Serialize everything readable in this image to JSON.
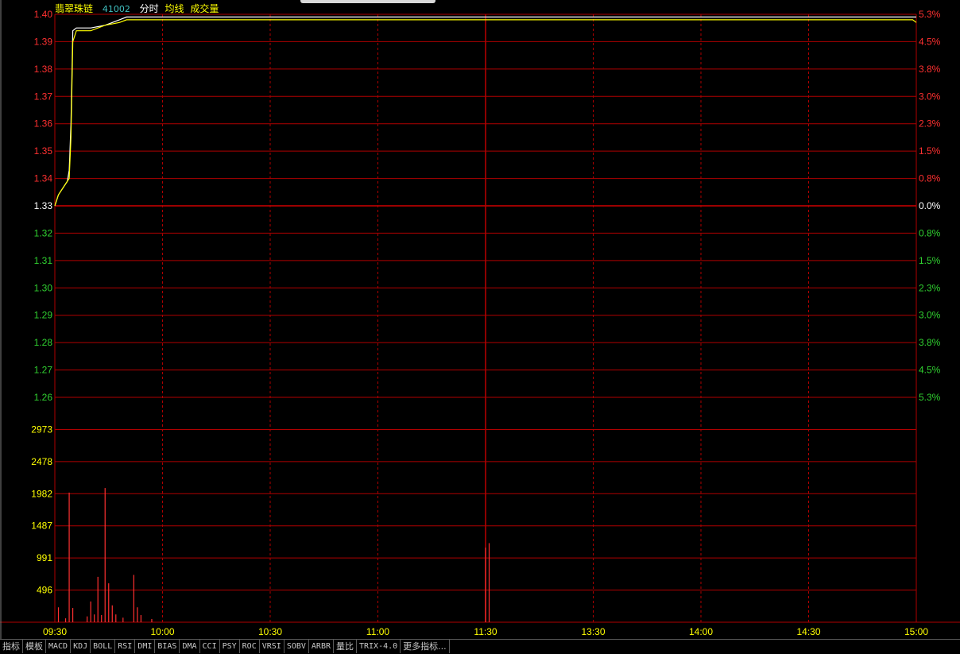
{
  "header": {
    "stock_name": "翡翠珠链",
    "code": "41002",
    "mode_label": "分时",
    "avg_label": "均线",
    "vol_label": "成交量"
  },
  "colors": {
    "price_line": "#ffffff",
    "avg_line": "#ffff00",
    "grid": "#b00000",
    "up": "#ff3030",
    "down": "#30d030",
    "flat": "#ffffff",
    "volume_axis": "#ffff00"
  },
  "toolbar": {
    "tabs": [
      "指标",
      "模板",
      "MACD",
      "KDJ",
      "BOLL",
      "RSI",
      "DMI",
      "BIAS",
      "DMA",
      "CCI",
      "PSY",
      "ROC",
      "VRSI",
      "SOBV",
      "ARBR",
      "量比",
      "TRIX-4.0",
      "更多指标..."
    ]
  },
  "chart_data": [
    {
      "type": "line",
      "name": "price",
      "prev_close": 1.33,
      "ylim": [
        1.26,
        1.4
      ],
      "yticks": [
        "1.40",
        "1.39",
        "1.38",
        "1.37",
        "1.36",
        "1.35",
        "1.34",
        "1.33",
        "1.32",
        "1.31",
        "1.30",
        "1.29",
        "1.28",
        "1.27",
        "1.26"
      ],
      "pct_ticks": [
        "5.3%",
        "4.5%",
        "3.8%",
        "3.0%",
        "2.3%",
        "1.5%",
        "0.8%",
        "0.0%",
        "0.8%",
        "1.5%",
        "2.3%",
        "3.0%",
        "3.8%",
        "4.5%",
        "5.3%"
      ],
      "x_labels": [
        "09:30",
        "10:00",
        "10:30",
        "11:00",
        "11:30",
        "13:30",
        "14:00",
        "14:30",
        "15:00"
      ],
      "total_minutes": 240,
      "series": [
        {
          "name": "price",
          "x": [
            0,
            1,
            2,
            3,
            3.5,
            4,
            4.5,
            5,
            6,
            10,
            14,
            18,
            20,
            25,
            240
          ],
          "values": [
            1.33,
            1.334,
            1.336,
            1.338,
            1.339,
            1.343,
            1.36,
            1.394,
            1.395,
            1.395,
            1.396,
            1.398,
            1.399,
            1.399,
            1.399
          ]
        },
        {
          "name": "average",
          "x": [
            0,
            1,
            2,
            3,
            4,
            4.5,
            5,
            6,
            10,
            14,
            18,
            20,
            25,
            239,
            240
          ],
          "values": [
            1.33,
            1.334,
            1.336,
            1.338,
            1.34,
            1.355,
            1.39,
            1.394,
            1.394,
            1.396,
            1.397,
            1.398,
            1.398,
            1.398,
            1.397
          ]
        }
      ]
    },
    {
      "type": "bar",
      "name": "volume",
      "ylim": [
        0,
        3469
      ],
      "yticks": [
        "2973",
        "2478",
        "1982",
        "1487",
        "991",
        "496"
      ],
      "ytick_values": [
        2973,
        2478,
        1982,
        1487,
        991,
        496
      ],
      "x": [
        1,
        3,
        4,
        5,
        9,
        10,
        11,
        12,
        13,
        14,
        15,
        16,
        17,
        19,
        22,
        23,
        24,
        27,
        120,
        121
      ],
      "values": [
        230,
        60,
        2000,
        220,
        90,
        320,
        120,
        700,
        110,
        2070,
        600,
        260,
        120,
        70,
        730,
        230,
        110,
        50,
        1150,
        1220
      ]
    }
  ]
}
